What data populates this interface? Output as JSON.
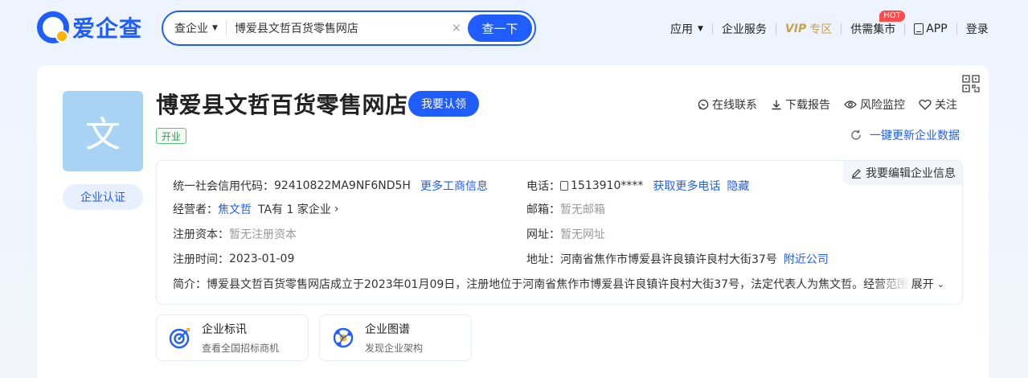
{
  "header": {
    "logo_text": "爱企查",
    "search": {
      "type_label": "查企业",
      "query": "博爱县文哲百货零售网店",
      "clear_icon": "×",
      "button_label": "查一下"
    },
    "nav": {
      "app_label": "应用",
      "enterprise_service": "企业服务",
      "vip_label": "VIP",
      "vip_zone": "专区",
      "supply_market": "供需集市",
      "hot_badge": "HOT",
      "app_download": "APP",
      "login": "登录"
    }
  },
  "company": {
    "avatar_char": "文",
    "cert_button": "企业认证",
    "name": "博爱县文哲百货零售网店",
    "claim_button": "我要认领",
    "status": "开业",
    "actions": {
      "contact": "在线联系",
      "download": "下载报告",
      "risk": "风险监控",
      "follow": "关注"
    },
    "refresh_label": "一键更新企业数据",
    "edit_label": "我要编辑企业信息",
    "info": {
      "credit_code_label": "统一社会信用代码：",
      "credit_code": "92410822MA9NF6ND5H",
      "more_business_link": "更多工商信息",
      "operator_label": "经营者：",
      "operator": "焦文哲",
      "operator_suffix": "TA有 1 家企业",
      "capital_label": "注册资本：",
      "capital": "暂无注册资本",
      "reg_date_label": "注册时间：",
      "reg_date": "2023-01-09",
      "phone_label": "电话：",
      "phone": "1513910****",
      "more_phone_link": "获取更多电话",
      "hide_link": "隐藏",
      "email_label": "邮箱：",
      "email": "暂无邮箱",
      "website_label": "网址：",
      "website": "暂无网址",
      "address_label": "地址：",
      "address": "河南省焦作市博爱县许良镇许良村大街37号",
      "nearby_link": "附近公司",
      "brief_label": "简介：",
      "brief": "博爱县文哲百货零售网店成立于2023年01月09日，注册地位于河南省焦作市博爱县许良镇许良村大街37号，法定代表人为焦文哲。经营范围包",
      "expand_label": "展开"
    },
    "tools": [
      {
        "title": "企业标讯",
        "subtitle": "查看全国招标商机"
      },
      {
        "title": "企业图谱",
        "subtitle": "发现企业架构"
      }
    ]
  },
  "colors": {
    "brand": "#1f5dff",
    "vip": "#c8a24a",
    "status_green": "#2e9d52",
    "hot": "#ff4b4b"
  },
  "icons": [
    "logo-icon",
    "chevron-down-icon",
    "clear-icon",
    "phone-icon",
    "chat-icon",
    "download-icon",
    "eye-icon",
    "heart-icon",
    "refresh-icon",
    "edit-icon",
    "qr-code-icon",
    "chevron-right-icon",
    "target-icon",
    "graph-icon"
  ]
}
